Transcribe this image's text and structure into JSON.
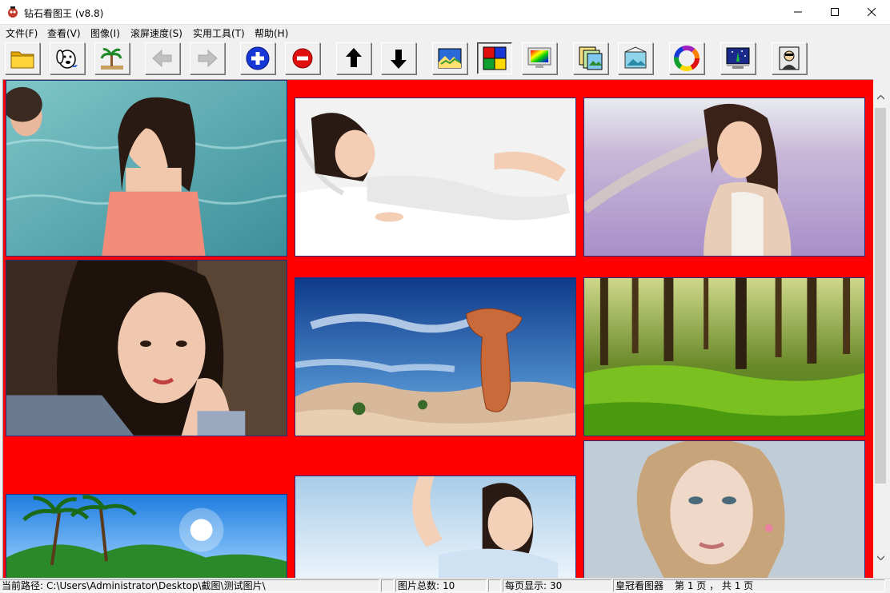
{
  "window": {
    "title": "钻石看图王 (v8.8)",
    "app_icon": "app-logo-icon",
    "controls": [
      "minimize-icon",
      "maximize-icon",
      "close-icon"
    ]
  },
  "menu": [
    {
      "label": "文件(F)"
    },
    {
      "label": "查看(V)"
    },
    {
      "label": "图像(I)"
    },
    {
      "label": "滚屏速度(S)"
    },
    {
      "label": "实用工具(T)"
    },
    {
      "label": "帮助(H)"
    }
  ],
  "toolbar": {
    "buttons": [
      {
        "icon": "folder-icon"
      },
      {
        "icon": "dog-icon"
      },
      {
        "icon": "palm-tree-icon"
      },
      {
        "icon": "arrow-left-icon",
        "disabled": true
      },
      {
        "icon": "arrow-right-icon",
        "disabled": true
      },
      {
        "icon": "zoom-in-plus-icon"
      },
      {
        "icon": "zoom-out-minus-icon"
      },
      {
        "icon": "arrow-up-icon"
      },
      {
        "icon": "arrow-down-icon"
      },
      {
        "icon": "slideshow-picture-icon"
      },
      {
        "icon": "color-grid-icon",
        "active": true
      },
      {
        "icon": "monitor-rainbow-icon"
      },
      {
        "icon": "image-stack-icon"
      },
      {
        "icon": "photo-frame-icon"
      },
      {
        "icon": "color-wheel-icon"
      },
      {
        "icon": "desktop-wallpaper-icon"
      },
      {
        "icon": "portrait-icon"
      }
    ]
  },
  "thumbnails": [
    {
      "subject": "woman-in-pool"
    },
    {
      "subject": "woman-on-white-bed"
    },
    {
      "subject": "woman-in-lavender-field"
    },
    {
      "subject": "woman-portrait-hand-on-face"
    },
    {
      "subject": "desert-rock-formation"
    },
    {
      "subject": "green-forest"
    },
    {
      "subject": "palm-beach"
    },
    {
      "subject": "woman-raising-arm"
    },
    {
      "subject": "blonde-woman-portrait"
    }
  ],
  "colors": {
    "content_background": "#ff0000",
    "thumbnail_border": "#2b2b7a"
  },
  "status": {
    "path_label": "当前路径:",
    "path_value": "C:\\Users\\Administrator\\Desktop\\截图\\测试图片\\",
    "total_label": "图片总数:",
    "total_value": "10",
    "per_page_label": "每页显示:",
    "per_page_value": "30",
    "app_name": "皇冠看图器",
    "page_info": "第 1 页 ， 共 1 页"
  }
}
